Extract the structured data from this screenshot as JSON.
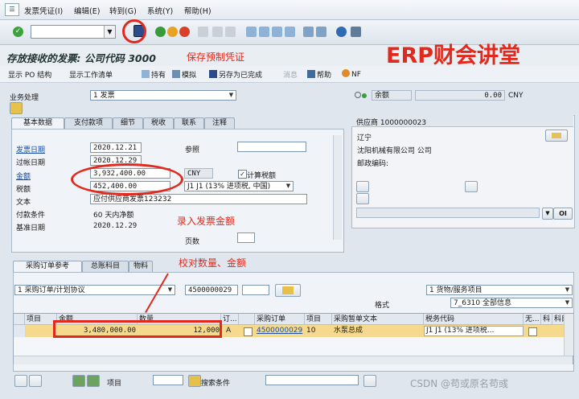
{
  "menubar": {
    "items": [
      "发票凭证(I)",
      "编辑(E)",
      "转到(G)",
      "系统(Y)",
      "帮助(H)"
    ]
  },
  "title": "存放接收的发票: 公司代码 3000",
  "app_toolbar": {
    "items": [
      "显示 PO 结构",
      "显示工作清单",
      "持有",
      "模拟",
      "另存为已完成",
      "消息",
      "帮助",
      "NF"
    ]
  },
  "transaction": {
    "label": "业务处理",
    "value": "1 发票"
  },
  "balance": {
    "label": "余额",
    "value": "0.00",
    "currency": "CNY"
  },
  "tabs": [
    "基本数据",
    "支付款项",
    "细节",
    "税收",
    "联系",
    "注释"
  ],
  "basic": {
    "invoice_date_label": "发票日期",
    "invoice_date": "2020.12.21",
    "posting_date_label": "过帐日期",
    "posting_date": "2020.12.29",
    "reference_label": "参照",
    "reference": "",
    "amount_label": "金额",
    "amount": "3,932,400.00",
    "currency": "CNY",
    "calc_tax_label": "计算税额",
    "tax_label": "税额",
    "tax": "452,400.00",
    "tax_code": "J1 J1 (13% 进项税, 中国)",
    "text_label": "文本",
    "text": "应付供应商发票123232",
    "payment_terms_label": "付款条件",
    "payment_terms": "60 天内净额",
    "baseline_label": "基准日期",
    "baseline": "2020.12.29",
    "page_label": "页数"
  },
  "vendor": {
    "header": "供应商 1000000023",
    "region": "辽宁",
    "name": "沈阳机械有限公司 公司",
    "postal_label": "邮政编码:",
    "oi_label": "OI"
  },
  "lower_tabs": [
    "采购订单参考",
    "总账科目",
    "物料"
  ],
  "po_ref": {
    "type": "1 采购订单/计划协议",
    "po_number": "4500000029",
    "item_type": "1 货物/服务项目",
    "layout_label": "格式",
    "layout_value": "7_6310 全部信息"
  },
  "grid": {
    "headers": [
      "项目",
      "金额",
      "数量",
      "订...",
      "",
      "采购订单",
      "项目",
      "采购暂单文本",
      "税务代码",
      "无...",
      "科",
      "科目"
    ],
    "row": {
      "amount": "3,480,000.00",
      "qty": "12,000",
      "unit": "A",
      "po": "4500000029",
      "item": "10",
      "text": "水泵总成",
      "tax_code": "J1  J1 (13% 进项税..."
    }
  },
  "bottom": {
    "item_label": "项目",
    "search_label": "搜索条件"
  },
  "annotations": {
    "watermark": "ERP财会讲堂",
    "save_note": "保存预制凭证",
    "amount_note": "录入发票金额",
    "check_note": "校对数量、金额",
    "csdn": "CSDN @苟或原名苟彧"
  },
  "colors": {
    "annotation_red": "#e12a1d",
    "row_highlight": "#f5d98c",
    "link_blue": "#1a4fa3"
  }
}
